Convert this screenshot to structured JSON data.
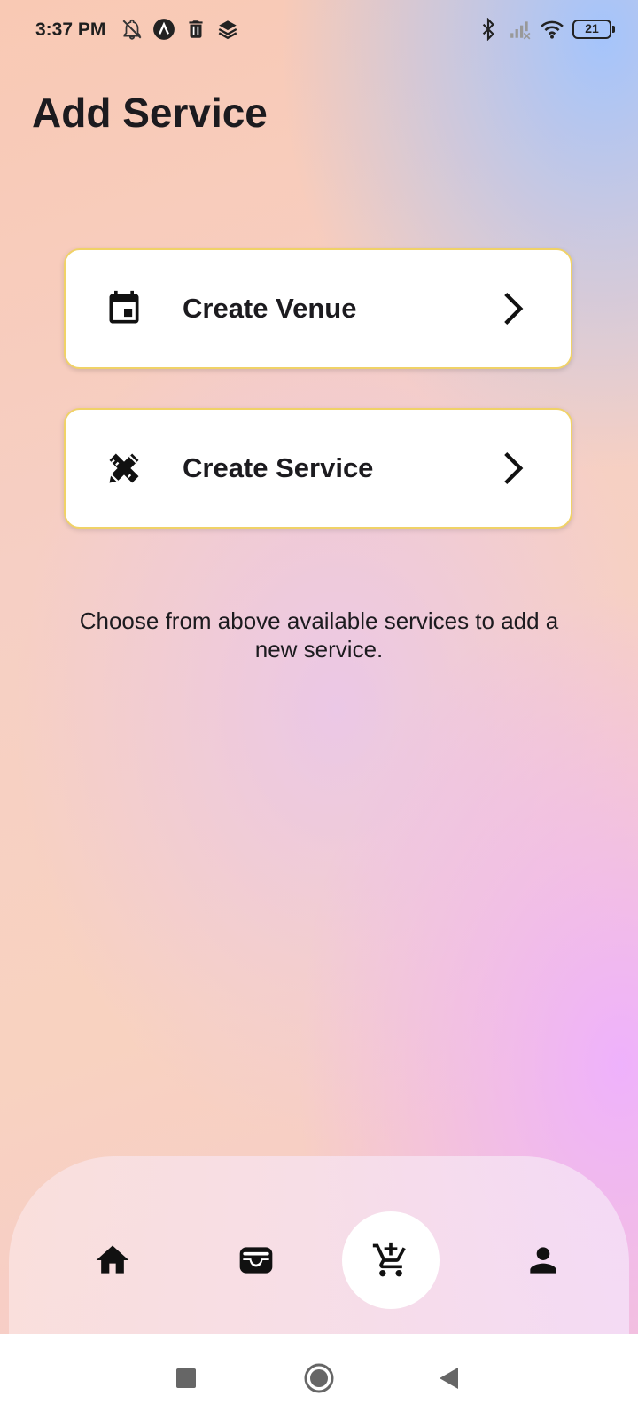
{
  "status_bar": {
    "time": "3:37 PM",
    "battery": "21",
    "left_icons": [
      "notifications-off-icon",
      "app-a-icon",
      "trash-icon",
      "layers-icon"
    ],
    "right_icons": [
      "bluetooth-icon",
      "cellular-signal-icon",
      "wifi-icon",
      "battery-icon"
    ]
  },
  "page": {
    "title": "Add Service",
    "helper_text": "Choose from above available services to add a new service."
  },
  "cards": [
    {
      "label": "Create Venue",
      "icon": "calendar-icon"
    },
    {
      "label": "Create Service",
      "icon": "design-tools-icon"
    }
  ],
  "bottom_nav": {
    "items": [
      {
        "icon": "home-icon",
        "selected": false
      },
      {
        "icon": "wallet-icon",
        "selected": false
      },
      {
        "icon": "add-to-cart-icon",
        "selected": true
      },
      {
        "icon": "person-icon",
        "selected": false
      }
    ]
  },
  "system_nav": [
    "recents-icon",
    "home-circle-icon",
    "back-icon"
  ],
  "colors": {
    "card_border": "#f0d267",
    "text": "#1c1b1f",
    "nav_selected_bg": "#ffffff"
  }
}
